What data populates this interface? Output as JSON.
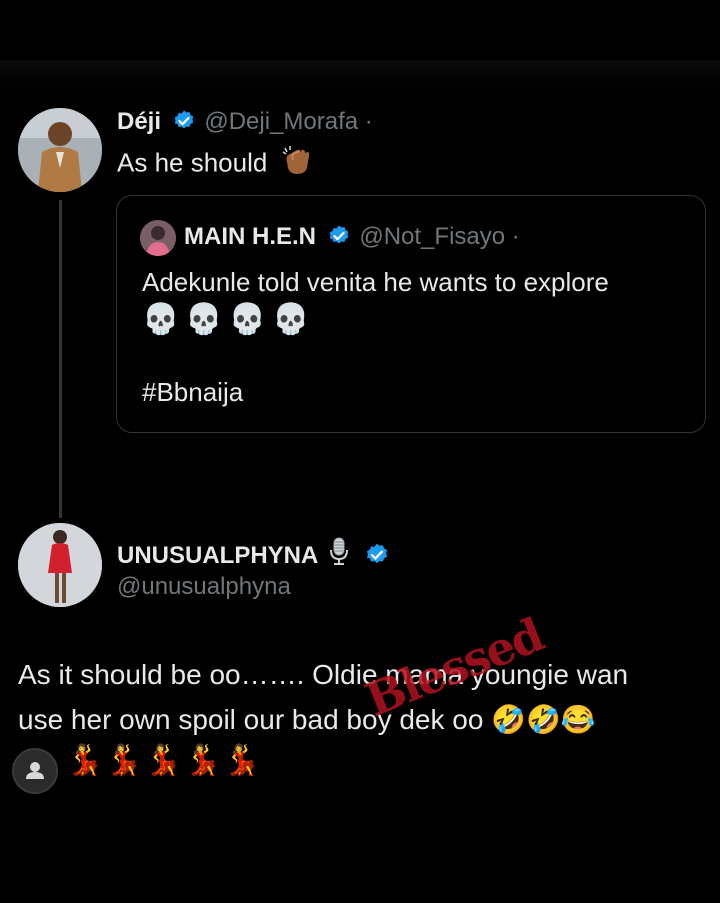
{
  "tweet1": {
    "name": "Déji",
    "handle": "@Deji_Morafa",
    "separator": "·",
    "text": "As he should",
    "emoji_icon": "clapping-hands-icon"
  },
  "quote": {
    "name": "MAIN H.E.N",
    "handle": "@Not_Fisayo",
    "separator": "·",
    "line1": "Adekunle told venita he wants to explore",
    "skulls": "💀💀💀💀",
    "hashtag": "#Bbnaija"
  },
  "tweet2": {
    "name": "UNUSUALPHYNA",
    "handle": "@unusualphyna",
    "line1": "As it should be oo……. Oldie mama youngie wan",
    "line2": "use her own spoil our bad boy dek oo 🤣🤣😂",
    "dancers": "💃💃💃💃💃"
  },
  "watermark_text": "Blessed",
  "colors": {
    "background": "#000000",
    "text": "#e7e9ea",
    "handle": "#71767b",
    "verified": "#1d9bf0",
    "watermark": "#b2121e"
  }
}
